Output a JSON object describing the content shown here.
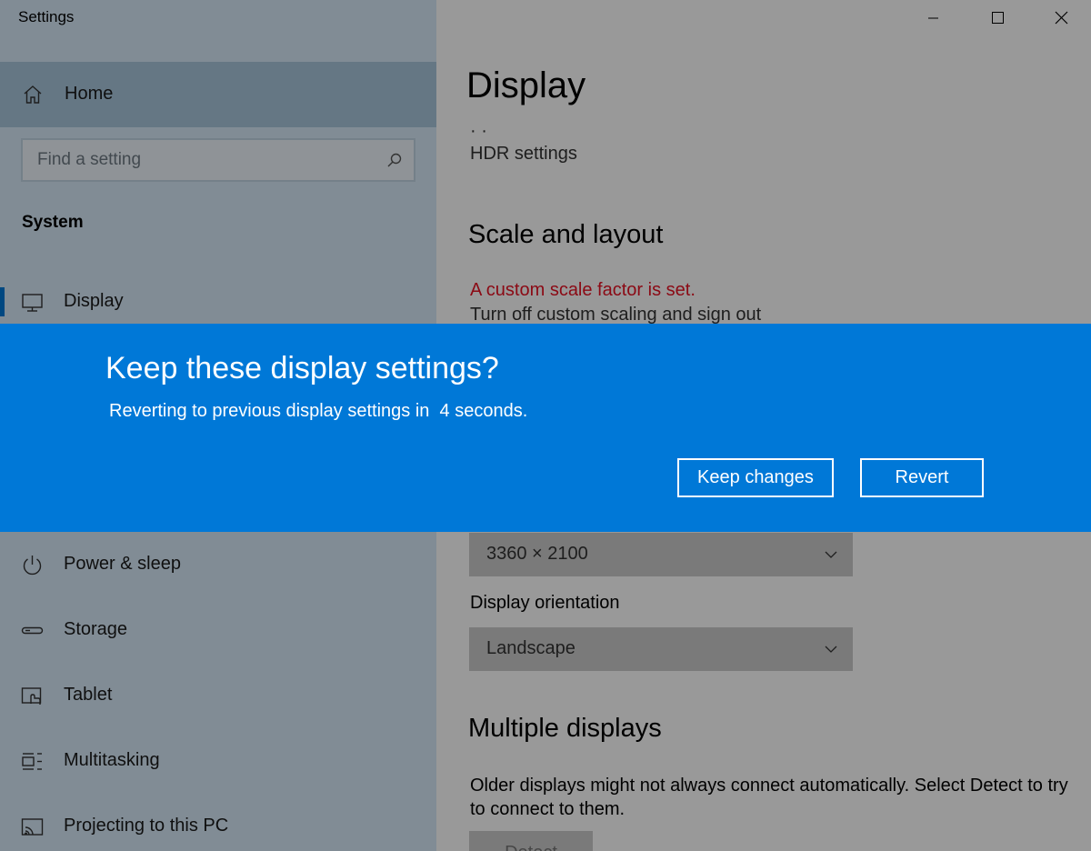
{
  "window": {
    "title": "Settings"
  },
  "sidebar": {
    "home_label": "Home",
    "search_placeholder": "Find a setting",
    "section_title": "System",
    "items": [
      {
        "label": "Display",
        "icon": "monitor-icon",
        "active": true
      },
      {
        "label": "Power & sleep",
        "icon": "power-icon"
      },
      {
        "label": "Storage",
        "icon": "storage-icon"
      },
      {
        "label": "Tablet",
        "icon": "tablet-icon"
      },
      {
        "label": "Multitasking",
        "icon": "multitasking-icon"
      },
      {
        "label": "Projecting to this PC",
        "icon": "projecting-icon"
      }
    ]
  },
  "main": {
    "page_title": "Display",
    "hdr_link": "HDR settings",
    "scale_heading": "Scale and layout",
    "scale_warning": "A custom scale factor is set.",
    "scale_link": "Turn off custom scaling and sign out",
    "resolution_value": "3360 × 2100",
    "orientation_label": "Display orientation",
    "orientation_value": "Landscape",
    "multiple_heading": "Multiple displays",
    "multiple_desc": "Older displays might not always connect automatically. Select Detect to try to connect to them.",
    "detect_label": "Detect"
  },
  "dialog": {
    "title": "Keep these display settings?",
    "message": "Reverting to previous display settings in  4 seconds.",
    "keep_label": "Keep changes",
    "revert_label": "Revert"
  },
  "colors": {
    "accent": "#0078d7",
    "warning": "#e81123",
    "sidebar_bg": "#d7eaf9"
  }
}
